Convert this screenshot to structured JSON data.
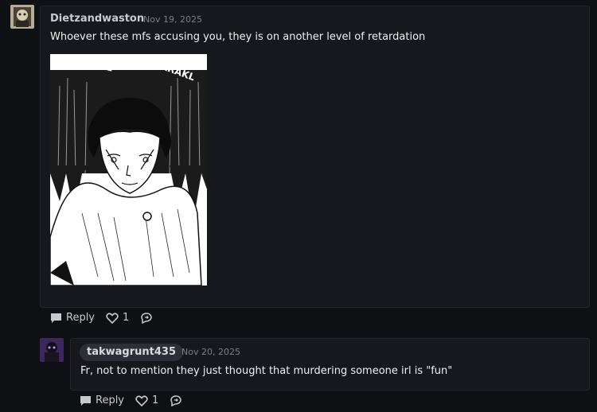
{
  "comments": [
    {
      "username": "Dietzandwaston",
      "date": "Nov 19, 2025",
      "text": "Whoever these mfs accusing you, they is on another level of retardation",
      "image": {
        "sfx": [
          "KRAKL",
          "KRAKL"
        ]
      },
      "actions": {
        "reply_label": "Reply",
        "like_count": "1"
      }
    },
    {
      "username": "takwagrunt435",
      "date": "Nov 20, 2025",
      "text": "Fr, not to mention they just thought that murdering someone irl is \"fun\"",
      "actions": {
        "reply_label": "Reply",
        "like_count": "1"
      }
    }
  ],
  "colors": {
    "background": "#0e1013",
    "card": "#16181d",
    "card_border": "#23262c",
    "muted": "#7b7f87"
  },
  "icons": [
    "comment-icon",
    "heart-icon",
    "share-icon"
  ]
}
